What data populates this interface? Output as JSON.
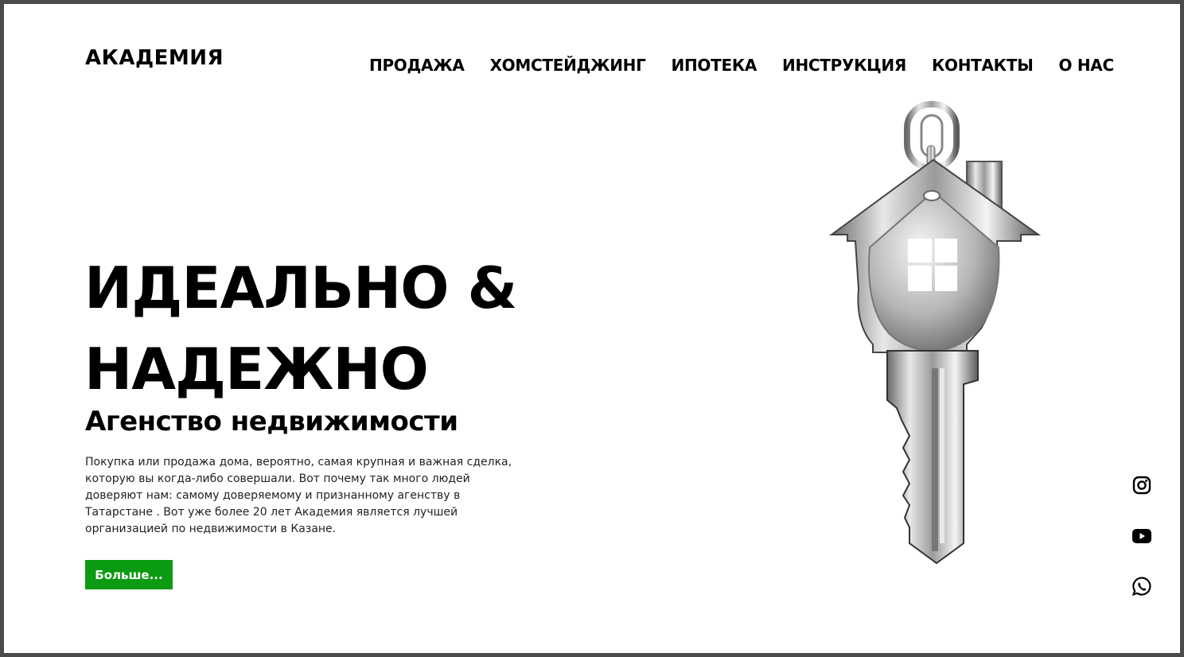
{
  "brand": {
    "logo": "АКАДЕМИЯ"
  },
  "nav": {
    "items": [
      "ПРОДАЖА",
      "ХОМСТЕЙДЖИНГ",
      "ИПОТЕКА",
      "ИНСТРУКЦИЯ",
      "КОНТАКТЫ",
      "О НАС"
    ]
  },
  "hero": {
    "title_line1": "ИДЕАЛЬНО &",
    "title_line2": "НАДЕЖНО",
    "subtitle": "Агенство недвижимости",
    "text": "Покупка или продажа дома, вероятно, самая крупная и важная сделка, которую вы когда-либо совершали. Вот почему так много людей доверяют нам: самому доверяемому и признанному агенству в Татарстане . Вот уже более 20 лет Академия является лучшей организацией по недвижимости в Казане.",
    "button_label": "Больше..."
  },
  "image": {
    "icon": "house-key-icon"
  },
  "social": [
    "instagram-icon",
    "youtube-icon",
    "whatsapp-icon"
  ],
  "colors": {
    "accent": "#0a9b12",
    "text": "#000000",
    "background": "#ffffff"
  }
}
